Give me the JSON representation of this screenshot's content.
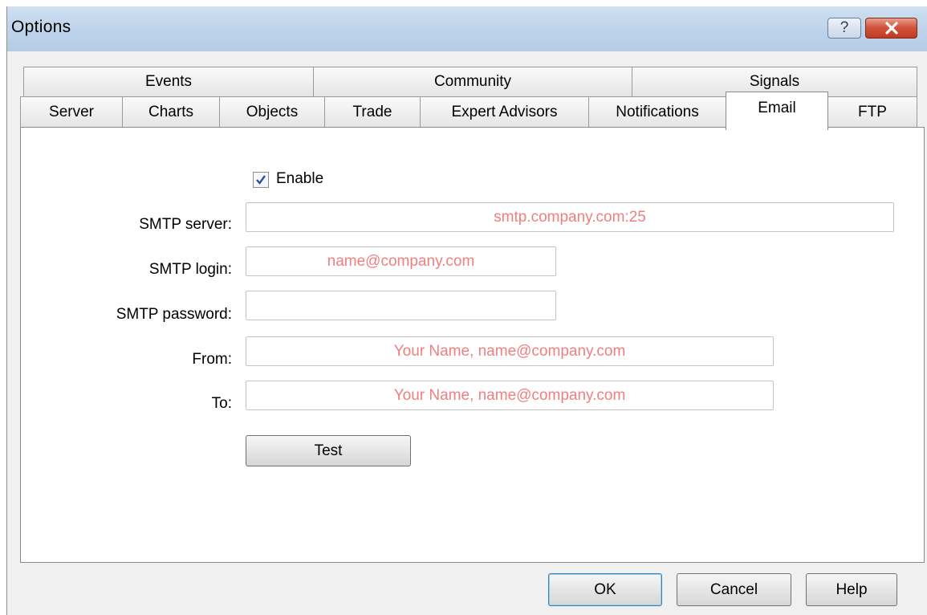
{
  "window": {
    "title": "Options",
    "help_glyph": "?",
    "close_icon": "close-icon"
  },
  "tabs": {
    "row1": [
      "Events",
      "Community",
      "Signals"
    ],
    "row2": [
      "Server",
      "Charts",
      "Objects",
      "Trade",
      "Expert Advisors",
      "Notifications",
      "Email",
      "FTP"
    ],
    "active": "Email"
  },
  "email": {
    "enable_label": "Enable",
    "enable_checked": true,
    "smtp_server_label": "SMTP server:",
    "smtp_server_value": "smtp.company.com:25",
    "smtp_login_label": "SMTP login:",
    "smtp_login_value": "name@company.com",
    "smtp_password_label": "SMTP password:",
    "smtp_password_value": "",
    "from_label": "From:",
    "from_value": "Your Name, name@company.com",
    "to_label": "To:",
    "to_value": "Your Name, name@company.com",
    "test_label": "Test"
  },
  "buttons": {
    "ok": "OK",
    "cancel": "Cancel",
    "help": "Help"
  },
  "colors": {
    "placeholder_text": "#ef7f7f",
    "title_bar": "#bfd4eb",
    "close_button": "#c9452e"
  }
}
